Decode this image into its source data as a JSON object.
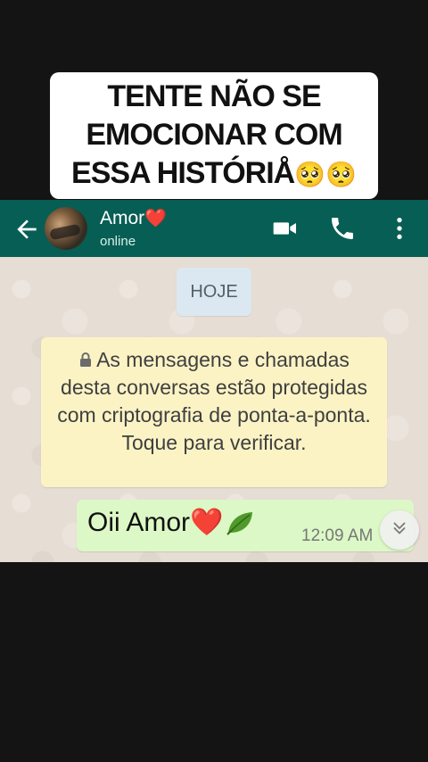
{
  "caption": {
    "line1": "TENTE NÃO SE",
    "line2": "EMOCIONAR COM",
    "line3": "ESSA HISTÓRIÅ",
    "emoji": "🥺🥺"
  },
  "header": {
    "contact_name": "Amor",
    "name_emoji": "❤️",
    "status": "online",
    "icons": [
      "back-arrow-icon",
      "video-call-icon",
      "phone-icon",
      "more-vert-icon"
    ],
    "color": "#075e54"
  },
  "chat": {
    "date_chip": "HOJE",
    "encryption_notice": "As mensagens e chamadas desta conversas estão protegidas com criptografia de ponta-a-ponta. Toque para verificar.",
    "messages": [
      {
        "text": "Oii Amor",
        "emoji": "❤️",
        "sticker": "leaf-icon",
        "time": "12:09 AM",
        "direction": "outgoing"
      }
    ],
    "bubble_color": "#dcf8c6",
    "notice_color": "#fcf3c5"
  }
}
